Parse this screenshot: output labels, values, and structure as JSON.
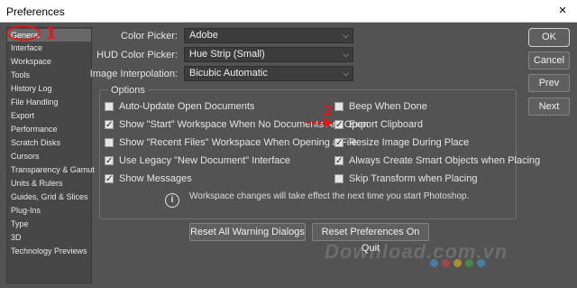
{
  "window": {
    "title": "Preferences",
    "close_glyph": "×"
  },
  "sidebar": {
    "items": [
      {
        "label": "General"
      },
      {
        "label": "Interface"
      },
      {
        "label": "Workspace"
      },
      {
        "label": "Tools"
      },
      {
        "label": "History Log"
      },
      {
        "label": "File Handling"
      },
      {
        "label": "Export"
      },
      {
        "label": "Performance"
      },
      {
        "label": "Scratch Disks"
      },
      {
        "label": "Cursors"
      },
      {
        "label": "Transparency & Gamut"
      },
      {
        "label": "Units & Rulers"
      },
      {
        "label": "Guides, Grid & Slices"
      },
      {
        "label": "Plug-Ins"
      },
      {
        "label": "Type"
      },
      {
        "label": "3D"
      },
      {
        "label": "Technology Previews"
      }
    ],
    "selected": "General"
  },
  "pickers": {
    "color_picker": {
      "label": "Color Picker:",
      "value": "Adobe"
    },
    "hud_color_picker": {
      "label": "HUD Color Picker:",
      "value": "Hue Strip (Small)"
    },
    "image_interpolation": {
      "label": "Image Interpolation:",
      "value": "Bicubic Automatic"
    }
  },
  "options": {
    "title": "Options",
    "left": [
      {
        "label": "Auto-Update Open Documents",
        "checked": false
      },
      {
        "label": "Show \"Start\" Workspace When No Documents Are Open",
        "checked": true
      },
      {
        "label": "Show \"Recent Files\" Workspace When Opening a File",
        "checked": false
      },
      {
        "label": "Use Legacy \"New Document\" Interface",
        "checked": true
      },
      {
        "label": "Show Messages",
        "checked": true
      }
    ],
    "right": [
      {
        "label": "Beep When Done",
        "checked": false
      },
      {
        "label": "Export Clipboard",
        "checked": true
      },
      {
        "label": "Resize Image During Place",
        "checked": true
      },
      {
        "label": "Always Create Smart Objects when Placing",
        "checked": true
      },
      {
        "label": "Skip Transform when Placing",
        "checked": false
      }
    ],
    "info": "Workspace changes will take effect the next time you start Photoshop.",
    "info_icon": "info-icon",
    "check_glyph": "✓"
  },
  "buttons": {
    "ok": "OK",
    "cancel": "Cancel",
    "prev": "Prev",
    "next": "Next",
    "reset_warnings": "Reset All Warning Dialogs",
    "reset_prefs": "Reset Preferences On Quit"
  },
  "annotations": {
    "step1": "1",
    "step2": "2",
    "color": "#e01818"
  },
  "watermark": {
    "text": "Download.com.vn"
  }
}
